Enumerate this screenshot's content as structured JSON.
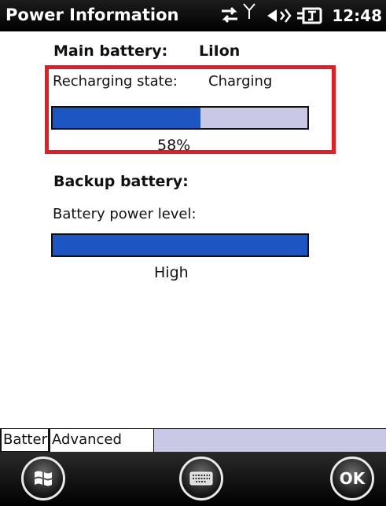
{
  "titlebar": {
    "title": "Power Information",
    "time": "12:48",
    "icons": [
      "sync-arrows-icon",
      "signal-antenna-icon",
      "speaker-volume-icon",
      "battery-charging-icon"
    ]
  },
  "main_battery": {
    "label": "Main battery:",
    "chemistry": "LiIon",
    "state_label": "Recharging state:",
    "state_value": "Charging",
    "level_text": "58%",
    "level_fraction": 0.58
  },
  "backup_battery": {
    "label": "Backup battery:",
    "power_label": "Battery power level:",
    "level_text": "High",
    "level_fraction": 1.0
  },
  "tabs": [
    {
      "label": "Battery",
      "active": true
    },
    {
      "label": "Advanced",
      "active": false
    }
  ],
  "softkeys": {
    "ok_label": "OK",
    "start_icon": "windows-start-icon",
    "keyboard_icon": "keyboard-icon"
  },
  "colors": {
    "progress_fill": "#1d55c3",
    "progress_track": "#c9c9e6",
    "highlight": "#e81a22"
  }
}
